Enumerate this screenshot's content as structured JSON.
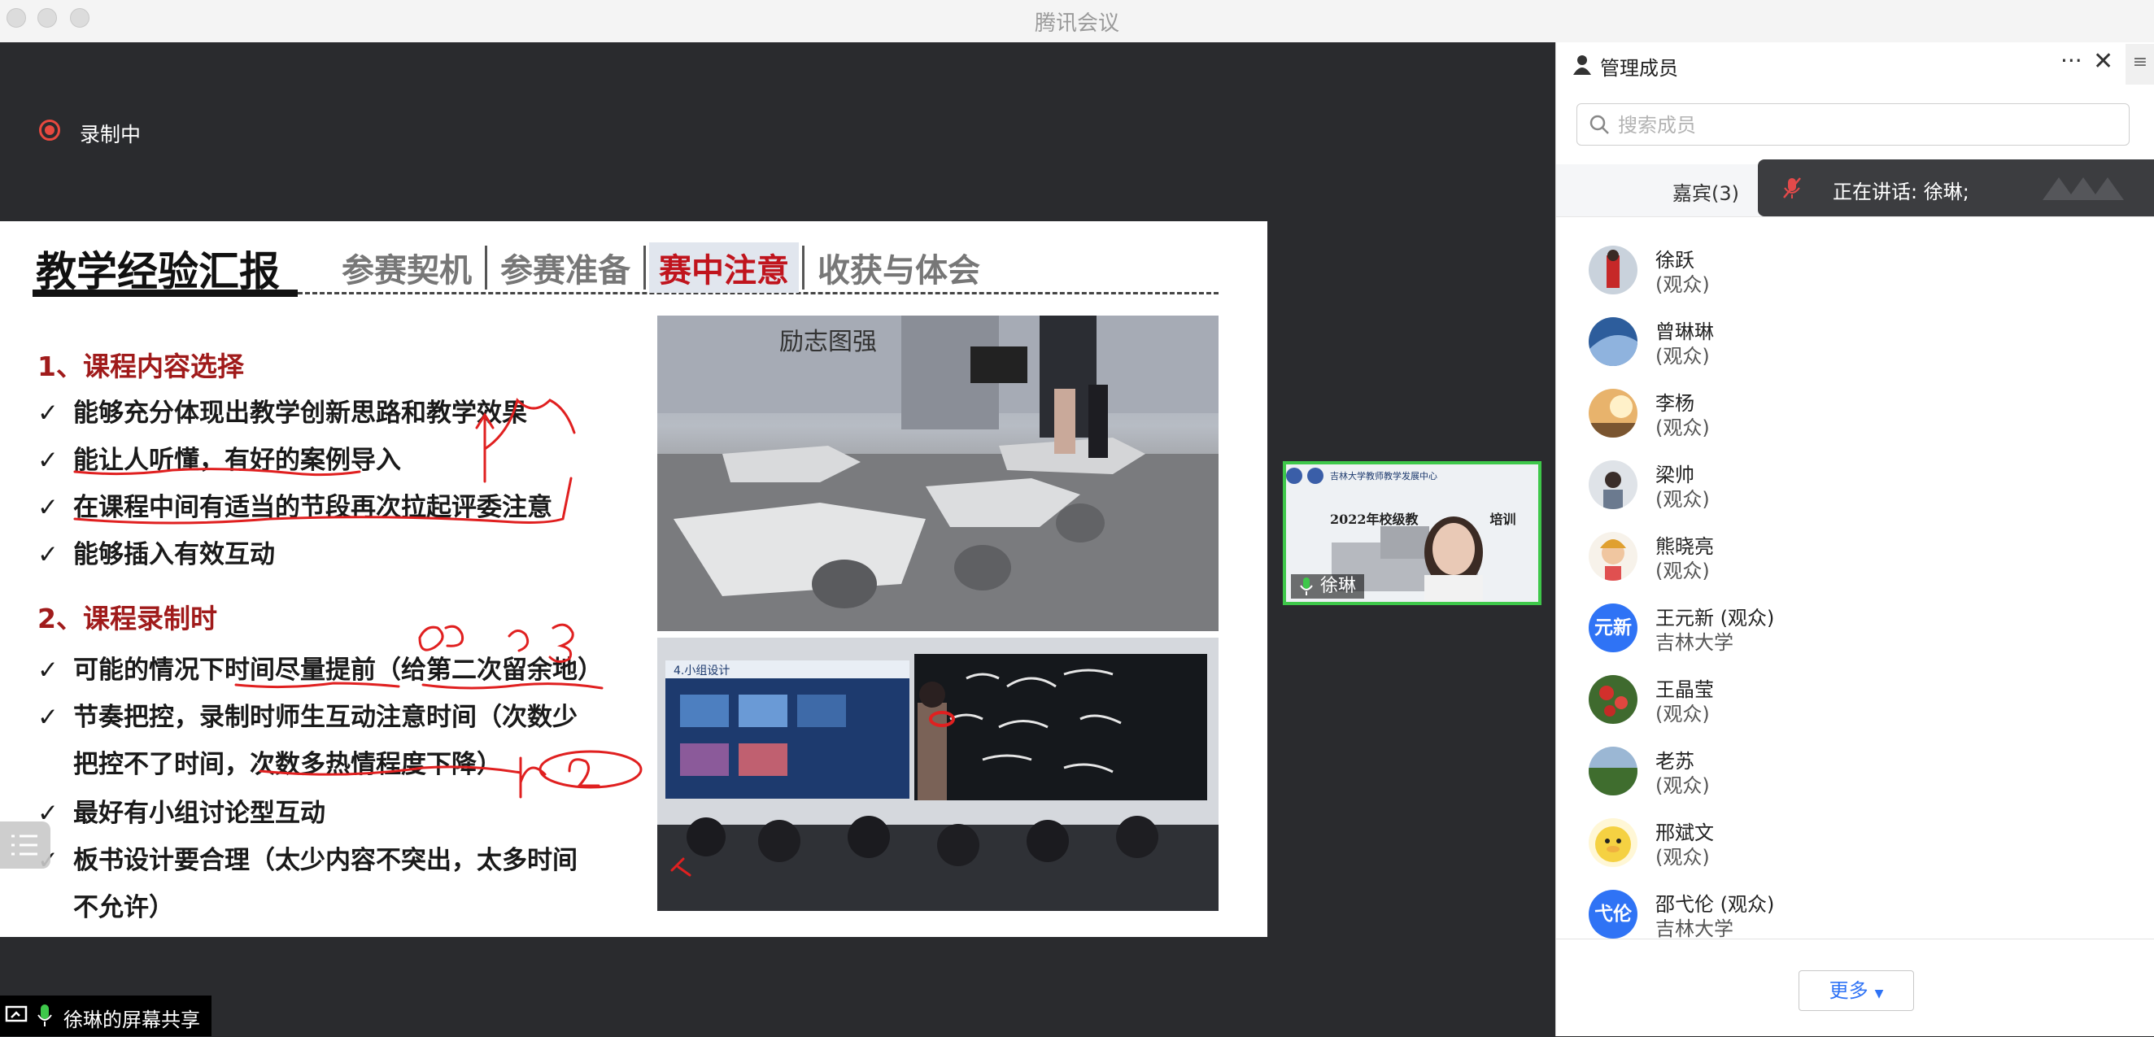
{
  "window": {
    "title": "腾讯会议"
  },
  "recording": {
    "label": "录制中"
  },
  "slide": {
    "title": "教学经验汇报",
    "tabs": [
      "参赛契机",
      "参赛准备",
      "赛中注意",
      "收获与体会"
    ],
    "active_tab": "赛中注意",
    "section1": "1、课程内容选择",
    "section1_items": [
      "能够充分体现出教学创新思路和教学效果",
      "能让人听懂，有好的案例导入",
      "在课程中间有适当的节段再次拉起评委注意",
      "能够插入有效互动"
    ],
    "section2": "2、课程录制时",
    "section2_items": [
      "可能的情况下时间尽量提前（给第二次留余地）",
      "节奏把控，录制时师生互动注意时间（次数少",
      "最好有小组讨论型互动",
      "板书设计要合理（太少内容不突出，太多时间"
    ],
    "section2_cont": [
      "把控不了时间，次数多热情程度下降）",
      "不允许）"
    ],
    "photo1_sign": "励志图强",
    "photo2_screen_title": "4.小组设计"
  },
  "share": {
    "label": "徐琳的屏幕共享"
  },
  "video": {
    "name": "徐琳",
    "caption": "2022年校级教",
    "caption_tail": "培训",
    "org": "吉林大学教师教学发展中心"
  },
  "panel": {
    "title": "管理成员",
    "search_placeholder": "搜索成员",
    "guest_tab": "嘉宾(3)",
    "speaking": "正在讲话: 徐琳;",
    "more_button": "更多",
    "members": [
      {
        "name": "徐跃",
        "sub": "(观众)",
        "avatar": "photo-red"
      },
      {
        "name": "曾琳琳",
        "sub": "(观众)",
        "avatar": "photo-blue"
      },
      {
        "name": "李杨",
        "sub": "(观众)",
        "avatar": "photo-sunset"
      },
      {
        "name": "梁帅",
        "sub": "(观众)",
        "avatar": "photo-person"
      },
      {
        "name": "熊晓亮",
        "sub": "(观众)",
        "avatar": "photo-cartoon"
      },
      {
        "name": "王元新 (观众)",
        "sub": "吉林大学",
        "avatar": "letter",
        "letters": "元新"
      },
      {
        "name": "王晶莹",
        "sub": "(观众)",
        "avatar": "photo-flower"
      },
      {
        "name": "老苏",
        "sub": "(观众)",
        "avatar": "photo-field"
      },
      {
        "name": "邢斌文",
        "sub": "(观众)",
        "avatar": "photo-duck"
      },
      {
        "name": "邵弋伦 (观众)",
        "sub": "吉林大学",
        "avatar": "letter",
        "letters": "弋伦"
      }
    ]
  },
  "colors": {
    "accent": "#2f73f5",
    "record_red": "#e8493f",
    "speaker_green": "#3ec84a",
    "slide_red": "#a01b1b"
  }
}
